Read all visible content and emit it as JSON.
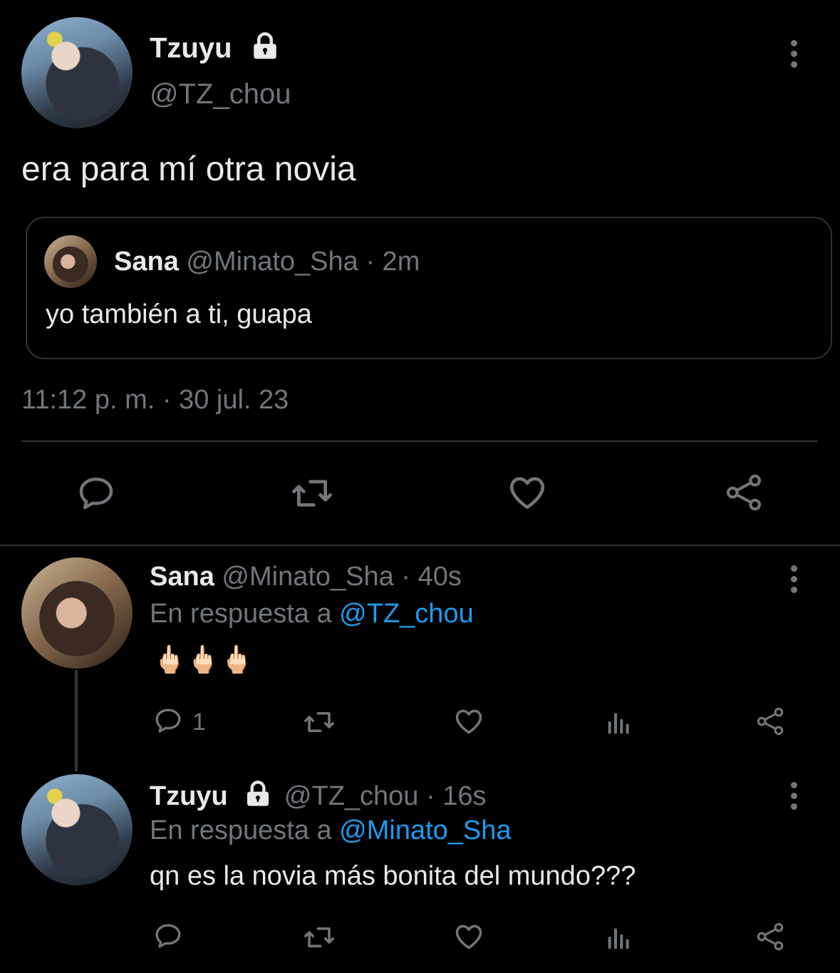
{
  "main_tweet": {
    "author_name": "Tzuyu",
    "author_handle": "@TZ_chou",
    "text": "era para mí otra novia",
    "timestamp": "11:12 p. m. · 30 jul. 23",
    "protected_icon": "lock-icon",
    "quoted": {
      "author_name": "Sana",
      "author_handle": "@Minato_Sha",
      "time": "· 2m",
      "text": "yo también a ti, guapa"
    },
    "actions": [
      "reply-icon",
      "retweet-icon",
      "like-icon",
      "share-icon"
    ]
  },
  "replies": [
    {
      "author_name": "Sana",
      "author_handle": "@Minato_Sha",
      "time": "· 40s",
      "reply_prefix": "En respuesta a",
      "reply_to": "@TZ_chou",
      "text": "🖕🏻🖕🏻🖕🏻",
      "reply_count": "1",
      "actions": [
        "reply-icon",
        "retweet-icon",
        "like-icon",
        "views-icon",
        "share-icon"
      ]
    },
    {
      "author_name": "Tzuyu",
      "author_handle": "@TZ_chou",
      "time": "· 16s",
      "reply_prefix": "En respuesta a",
      "reply_to": "@Minato_Sha",
      "text": "qn es la novia más bonita del mundo???",
      "reply_count": "",
      "actions": [
        "reply-icon",
        "retweet-icon",
        "like-icon",
        "views-icon",
        "share-icon"
      ]
    }
  ],
  "colors": {
    "background": "#000000",
    "text": "#e7e9ea",
    "muted": "#71767b",
    "link": "#1d9bf0",
    "border": "#2f3336"
  }
}
